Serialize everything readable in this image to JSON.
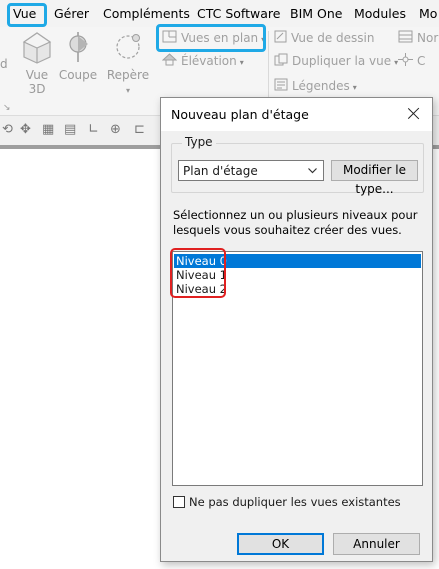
{
  "menubar": {
    "items": [
      "Vue",
      "Gérer",
      "Compléments",
      "CTC Software",
      "BIM One",
      "Modules",
      "Mo"
    ]
  },
  "ribbon": {
    "big_buttons": [
      {
        "label": "Vue\n3D",
        "icon": "house-3d-icon"
      },
      {
        "label": "Coupe",
        "icon": "section-icon"
      },
      {
        "label": "Repère",
        "icon": "callout-icon"
      }
    ],
    "small_buttons": {
      "vues_en_plan": "Vues en plan",
      "elevation": "Élévation",
      "vue_de_dessin": "Vue de dessin",
      "dupliquer_la_vue": "Dupliquer la vue",
      "legendes": "Légendes",
      "nor": "Nor",
      "ca": "C"
    },
    "left_edge_label": "d"
  },
  "dialog": {
    "title": "Nouveau plan d'étage",
    "type_group_label": "Type",
    "type_selected": "Plan d'étage",
    "modify_type_button": "Modifier le type...",
    "instruction": "Sélectionnez un ou plusieurs niveaux pour lesquels vous souhaitez créer des vues.",
    "levels": [
      {
        "label": "Niveau 0",
        "selected": true
      },
      {
        "label": "Niveau 1",
        "selected": false
      },
      {
        "label": "Niveau 2",
        "selected": false
      }
    ],
    "no_duplicate_checkbox": "Ne pas dupliquer les vues existantes",
    "no_duplicate_checked": false,
    "ok_button": "OK",
    "cancel_button": "Annuler"
  },
  "colors": {
    "highlight_blue": "#1fa9e6",
    "highlight_red": "#e02020",
    "selection_blue": "#0078d7"
  }
}
